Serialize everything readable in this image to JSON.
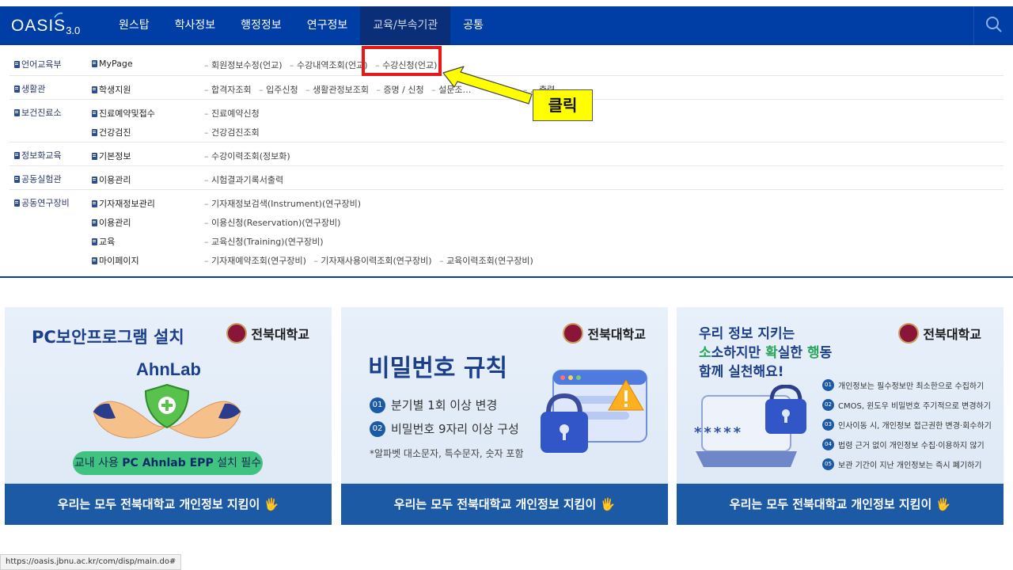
{
  "header": {
    "logo_text": "OASIS",
    "logo_version": "3.0",
    "menu": [
      "원스탑",
      "학사정보",
      "행정정보",
      "연구정보",
      "교육/부속기관",
      "공통"
    ],
    "active_menu": "교육/부속기관"
  },
  "mega_menu": {
    "rows": [
      {
        "category": "언어교육부",
        "sub": "MyPage",
        "links": [
          "회원정보수정(언교)",
          "수강내역조회(언교)",
          "수강신청(언교)"
        ]
      },
      {
        "category": "생활관",
        "sub": "학생지원",
        "links": [
          "합격자조회",
          "입주신청",
          "생활관정보조회",
          "증명 / 신청",
          "설문조…",
          "…출력"
        ]
      },
      {
        "category": "보건진료소",
        "sub": "진료예약및접수",
        "links": [
          "진료예약신청"
        ]
      },
      {
        "category": "",
        "sub": "건강검진",
        "links": [
          "건강검진조회"
        ]
      },
      {
        "category": "정보화교육",
        "sub": "기본정보",
        "links": [
          "수강이력조회(정보화)"
        ]
      },
      {
        "category": "공동실험관",
        "sub": "이용관리",
        "links": [
          "시험결과기록서출력"
        ]
      },
      {
        "category": "공동연구장비",
        "sub": "기자재정보관리",
        "links": [
          "기자재정보검색(Instrument)(연구장비)"
        ]
      },
      {
        "category": "",
        "sub": "이용관리",
        "links": [
          "이용신청(Reservation)(연구장비)"
        ]
      },
      {
        "category": "",
        "sub": "교육",
        "links": [
          "교육신청(Training)(연구장비)"
        ]
      },
      {
        "category": "",
        "sub": "마이페이지",
        "links": [
          "기자재예약조회(연구장비)",
          "기자재사용이력조회(연구장비)",
          "교육이력조회(연구장비)"
        ]
      }
    ]
  },
  "annotation": {
    "callout_text": "클릭",
    "highlight_color": "#e81818",
    "callout_color": "#ffff00"
  },
  "banners": {
    "university": "전북대학교",
    "footer": "우리는 모두 전북대학교 개인정보 지킴이 🖐",
    "security": {
      "title": "PC보안프로그램 설치",
      "brand": "AhnLab",
      "pill_pre": "교내 사용 ",
      "pill_bold": "PC  Ahnlab EPP",
      "pill_post": " 설치 필수"
    },
    "password": {
      "title": "비밀번호 규칙",
      "rules": [
        {
          "num": "01",
          "text": "분기별 1회 이상 변경"
        },
        {
          "num": "02",
          "text": "비밀번호 9자리 이상 구성"
        }
      ],
      "note": "*알파벳 대소문자, 특수문자, 숫자 포함"
    },
    "privacy": {
      "title_line1": "우리 정보 지키는",
      "title_line2_a": "소",
      "title_line2_b": "소하지만 ",
      "title_line2_c": "확",
      "title_line2_d": "실한 ",
      "title_line2_e": "행",
      "title_line2_f": "동",
      "title_line3": "함께 실천해요!",
      "password_mask": "*****",
      "items": [
        {
          "num": "01",
          "text": "개인정보는 필수정보만 최소한으로 수집하기"
        },
        {
          "num": "02",
          "text": "CMOS, 윈도우 비밀번호 주기적으로 변경하기"
        },
        {
          "num": "03",
          "text": "인사이동 시, 개인정보 접근권한 변경·회수하기"
        },
        {
          "num": "04",
          "text": "법령 근거 없이 개인정보 수집·이용하지 않기"
        },
        {
          "num": "05",
          "text": "보관 기간이 지난 개인정보는 즉시 폐기하기"
        }
      ]
    }
  },
  "status_url": "https://oasis.jbnu.ac.kr/com/disp/main.do#",
  "colors": {
    "nav": "#003da5",
    "nav_active": "#0b2e78",
    "banner_footer": "#1d5aa6",
    "green": "#40c281"
  }
}
